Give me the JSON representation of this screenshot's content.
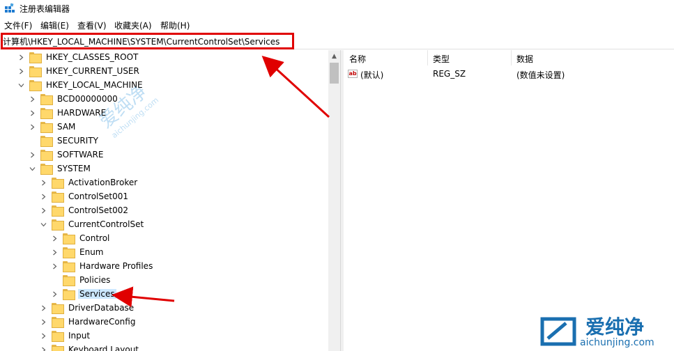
{
  "window": {
    "title": "注册表编辑器",
    "icon": "registry-editor-icon"
  },
  "menu": [
    {
      "label": "文件(F)"
    },
    {
      "label": "编辑(E)"
    },
    {
      "label": "查看(V)"
    },
    {
      "label": "收藏夹(A)"
    },
    {
      "label": "帮助(H)"
    }
  ],
  "address": {
    "path": "计算机\\HKEY_LOCAL_MACHINE\\SYSTEM\\CurrentControlSet\\Services"
  },
  "tree": [
    {
      "label": "HKEY_CLASSES_ROOT",
      "expander": "collapsed"
    },
    {
      "label": "HKEY_CURRENT_USER",
      "expander": "collapsed"
    },
    {
      "label": "HKEY_LOCAL_MACHINE",
      "expander": "expanded"
    },
    {
      "label": "BCD00000000",
      "expander": "collapsed"
    },
    {
      "label": "HARDWARE",
      "expander": "collapsed"
    },
    {
      "label": "SAM",
      "expander": "collapsed"
    },
    {
      "label": "SECURITY",
      "expander": "none"
    },
    {
      "label": "SOFTWARE",
      "expander": "collapsed"
    },
    {
      "label": "SYSTEM",
      "expander": "expanded"
    },
    {
      "label": "ActivationBroker",
      "expander": "collapsed"
    },
    {
      "label": "ControlSet001",
      "expander": "collapsed"
    },
    {
      "label": "ControlSet002",
      "expander": "collapsed"
    },
    {
      "label": "CurrentControlSet",
      "expander": "expanded"
    },
    {
      "label": "Control",
      "expander": "collapsed"
    },
    {
      "label": "Enum",
      "expander": "collapsed"
    },
    {
      "label": "Hardware Profiles",
      "expander": "collapsed"
    },
    {
      "label": "Policies",
      "expander": "none"
    },
    {
      "label": "Services",
      "expander": "collapsed",
      "selected": true
    },
    {
      "label": "DriverDatabase",
      "expander": "collapsed"
    },
    {
      "label": "HardwareConfig",
      "expander": "collapsed"
    },
    {
      "label": "Input",
      "expander": "collapsed"
    },
    {
      "label": "Keyboard Layout",
      "expander": "collapsed"
    }
  ],
  "list": {
    "columns": [
      "名称",
      "类型",
      "数据"
    ],
    "rows": [
      {
        "name": "(默认)",
        "type": "REG_SZ",
        "data": "(数值未设置)",
        "icon": "string-value-icon"
      }
    ]
  },
  "watermark": {
    "center_cn": "爱纯净",
    "center_url": "aichunjing.com",
    "corner_cn": "爱纯净",
    "corner_url": "aichunjing.com"
  },
  "colors": {
    "annotation_red": "#e00000",
    "selection": "#cce8ff",
    "folder": "#ffd86b"
  }
}
